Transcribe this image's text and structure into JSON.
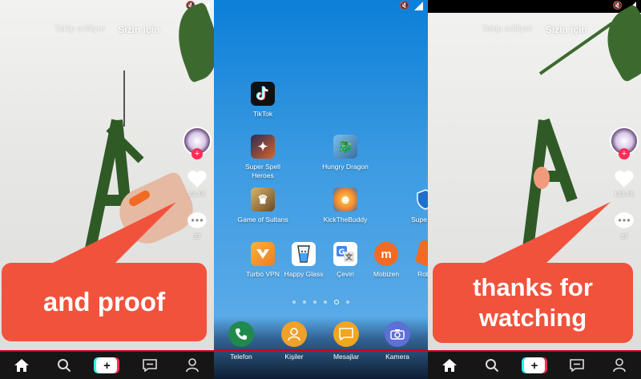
{
  "left_panel": {
    "tabs": {
      "following": "Takip ediliyor",
      "for_you": "Sizin için"
    },
    "likes": "24.4K",
    "comments": "37",
    "caption": "and proof"
  },
  "middle_panel": {
    "apps": [
      {
        "label": "TikTok",
        "icon": "tiktok-icon",
        "color": "#111111"
      },
      {
        "label": "Super Spell Heroes",
        "icon": "super-spell-heroes-icon",
        "color": "#2b2a55"
      },
      {
        "label": "Hungry Dragon",
        "icon": "hungry-dragon-icon",
        "color": "#4e90c8"
      },
      {
        "label": "Game of Sultans",
        "icon": "game-of-sultans-icon",
        "color": "#9a7a4a"
      },
      {
        "label": "KickTheBuddy",
        "icon": "kick-the-buddy-icon",
        "color": "#e8622a"
      },
      {
        "label": "Supe",
        "icon": "shield-app-icon",
        "color": "#2a78d4"
      },
      {
        "label": "Turbo VPN",
        "icon": "turbo-vpn-icon",
        "color": "#f29a2e"
      },
      {
        "label": "Happy Glass",
        "icon": "happy-glass-icon",
        "color": "#ffffff"
      },
      {
        "label": "Çeviri",
        "icon": "translate-icon",
        "color": "#ffffff"
      },
      {
        "label": "Mobizen",
        "icon": "mobizen-icon",
        "color": "#f36a22"
      },
      {
        "label": "Rob",
        "icon": "roblox-icon",
        "color": "#f36a22"
      }
    ],
    "dock": [
      {
        "label": "Telefon",
        "icon": "phone-icon",
        "color": "#1f8a4c"
      },
      {
        "label": "Kişiler",
        "icon": "contacts-icon",
        "color": "#f0a12a"
      },
      {
        "label": "Mesajlar",
        "icon": "messages-icon",
        "color": "#f2a51f"
      },
      {
        "label": "Kamera",
        "icon": "camera-icon",
        "color": "#5e6fd6"
      }
    ],
    "page_indicator": {
      "pages": 6,
      "current": 5
    }
  },
  "right_panel": {
    "tabs": {
      "following": "Takip ediliyor",
      "for_you": "Sizin için"
    },
    "likes": "123.4K",
    "comments": "37",
    "caption_line1": "thanks for",
    "caption_line2": "watching"
  },
  "colors": {
    "caption_bg": "#f1523c",
    "nav_red": "#d0021b",
    "tiktok_pink": "#fe2c55",
    "tiktok_cyan": "#25f4ee"
  }
}
